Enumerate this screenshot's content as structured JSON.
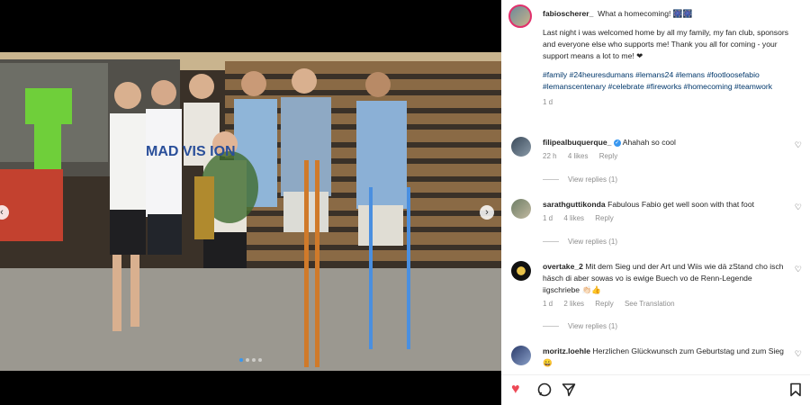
{
  "post": {
    "author": "fabioscherer_",
    "caption_first": "What a homecoming! 🎆🎆",
    "caption_body": "Last night i was welcomed home by all my family, my fan club, sponsors and everyone else who supports me! Thank you all for coming - your support means a lot to me! ❤",
    "hashtags": "#family #24heuresdumans #lemans24 #lemans #footloosefabio #lemanscentenary #celebrate #fireworks #homecoming #teamwork",
    "age": "1 d"
  },
  "photo": {
    "shirt_text": "MAD VIS ION"
  },
  "carousel": {
    "prev": "‹",
    "next": "›",
    "dots": 4,
    "active": 1
  },
  "comments": [
    {
      "user": "filipealbuquerque_",
      "verified": true,
      "text": "Ahahah so cool",
      "time": "22 h",
      "likes": "4 likes",
      "reply": "Reply",
      "translation": "",
      "view_replies": "View replies (1)"
    },
    {
      "user": "sarathguttikonda",
      "verified": false,
      "text": "Fabulous Fabio get well soon with that foot",
      "time": "1 d",
      "likes": "4 likes",
      "reply": "Reply",
      "translation": "",
      "view_replies": "View replies (1)"
    },
    {
      "user": "overtake_2",
      "verified": false,
      "text": "Mit dem Sieg und der Art und Wiis wie dä zStand cho isch häsch di aber sowas vo is ewige Buech vo de Renn-Legende iigschriebe 👏🏻👍",
      "time": "1 d",
      "likes": "2 likes",
      "reply": "Reply",
      "translation": "See Translation",
      "view_replies": "View replies (1)"
    },
    {
      "user": "moritz.loehle",
      "verified": false,
      "text": "Herzlichen Glückwunsch zum Geburtstag und zum Sieg 😀",
      "time": "",
      "likes": "",
      "reply": "",
      "translation": "",
      "view_replies": ""
    }
  ],
  "icons": {
    "like": "heart-icon",
    "comment": "comment-icon",
    "share": "share-icon",
    "save": "bookmark-icon",
    "like_color": "#ed4956"
  }
}
